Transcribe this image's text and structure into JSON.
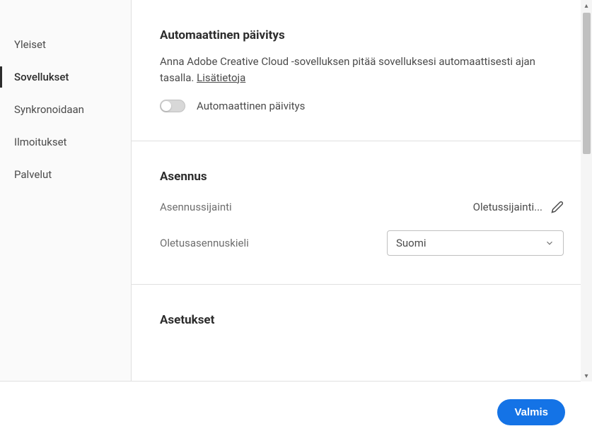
{
  "sidebar": {
    "items": [
      {
        "label": "Yleiset",
        "active": false
      },
      {
        "label": "Sovellukset",
        "active": true
      },
      {
        "label": "Synkronoidaan",
        "active": false
      },
      {
        "label": "Ilmoitukset",
        "active": false
      },
      {
        "label": "Palvelut",
        "active": false
      }
    ]
  },
  "sections": {
    "autoUpdate": {
      "title": "Automaattinen päivitys",
      "description": "Anna Adobe Creative Cloud -sovelluksen pitää sovelluksesi automaattisesti ajan tasalla. ",
      "linkText": "Lisätietoja",
      "toggleLabel": "Automaattinen päivitys",
      "toggleOn": false
    },
    "install": {
      "title": "Asennus",
      "locationLabel": "Asennussijainti",
      "locationValue": "Oletussijainti...",
      "langLabel": "Oletusasennuskieli",
      "langValue": "Suomi"
    },
    "settings": {
      "title": "Asetukset"
    }
  },
  "footer": {
    "doneLabel": "Valmis"
  }
}
